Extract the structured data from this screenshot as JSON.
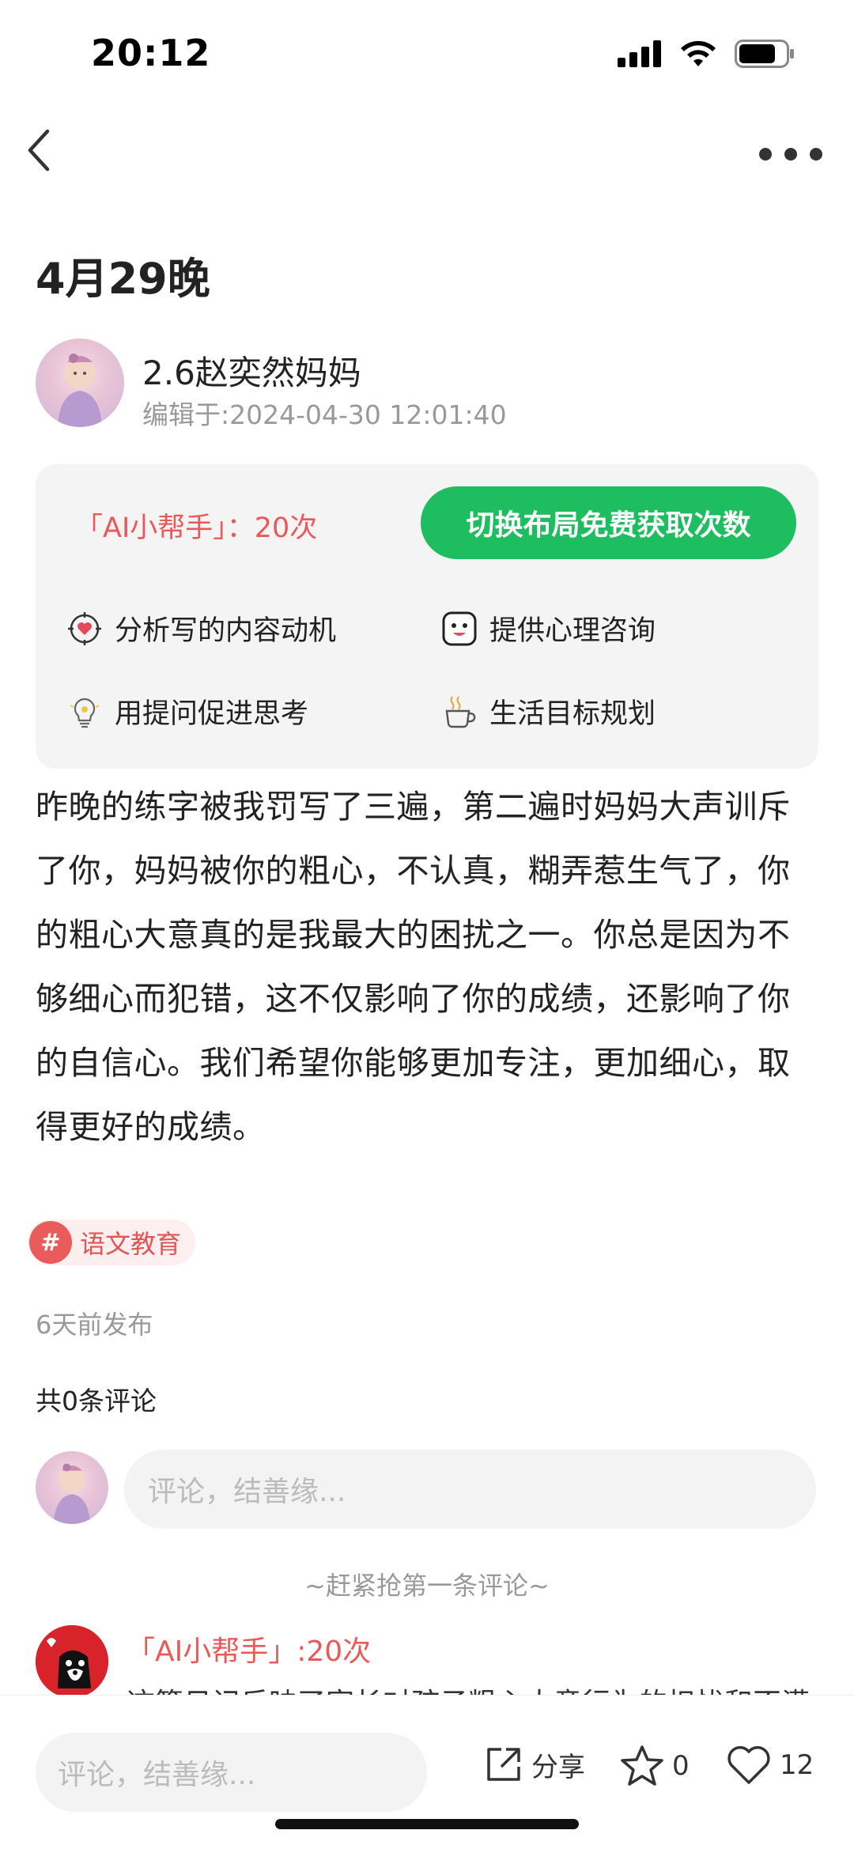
{
  "status": {
    "time": "20:12"
  },
  "post": {
    "title": "4月29晚",
    "author_name": "2.6赵奕然妈妈",
    "edit_time": "编辑于:2024-04-30 12:01:40",
    "content": "昨晚的练字被我罚写了三遍，第二遍时妈妈大声训斥了你，妈妈被你的粗心，不认真，糊弄惹生气了，你的粗心大意真的是我最大的困扰之一。你总是因为不够细心而犯错，这不仅影响了你的成绩，还影响了你的自信心。我们希望你能够更加专注，更加细心，取得更好的成绩。",
    "tag": "语文教育",
    "tag_hash": "#",
    "publish_time": "6天前发布",
    "comment_count": "共0条评论"
  },
  "ai_box": {
    "count_label": "「AI小帮手」：20次",
    "switch_button": "切换布局免费获取次数",
    "features": [
      {
        "label": "分析写的内容动机",
        "icon": "target-heart-icon"
      },
      {
        "label": "提供心理咨询",
        "icon": "smiley-icon"
      },
      {
        "label": "用提问促进思考",
        "icon": "lightbulb-icon"
      },
      {
        "label": "生活目标规划",
        "icon": "coffee-cup-icon"
      }
    ]
  },
  "comments": {
    "input_placeholder": "评论，结善缘...",
    "first_hint": "~赶紧抢第一条评论~",
    "ai_reply_name": "「AI小帮手」:20次",
    "ai_reply_text": "这篇日记反映了家长对孩子粗心大意行为的担忧和不满"
  },
  "bottom_bar": {
    "input_placeholder": "评论，结善缘...",
    "share_label": "分享",
    "favorite_count": "0",
    "like_count": "12"
  },
  "colors": {
    "accent_green": "#1ebd5f",
    "accent_red": "#e85a5a",
    "box_bg": "#f4f4f5"
  }
}
